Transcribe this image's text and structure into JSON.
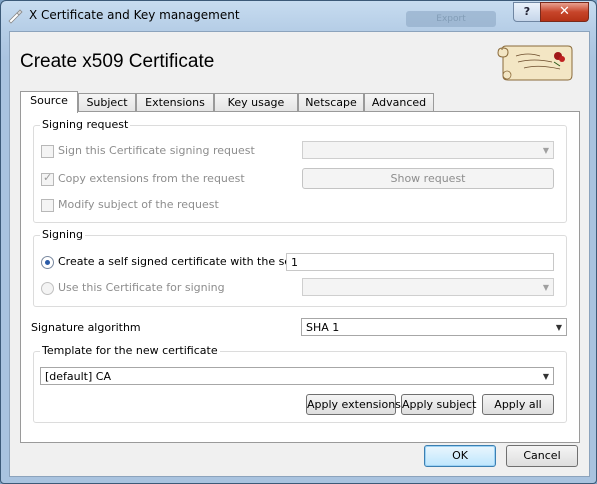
{
  "window": {
    "title": "X Certificate and Key management",
    "background_tab": "Export",
    "help_label": "?",
    "close_label": "✕"
  },
  "heading": "Create x509 Certificate",
  "tabs": [
    "Source",
    "Subject",
    "Extensions",
    "Key usage",
    "Netscape",
    "Advanced"
  ],
  "active_tab": "Source",
  "signing_request": {
    "legend": "Signing request",
    "sign_csr_label": "Sign this Certificate signing request",
    "sign_csr_checked": false,
    "copy_ext_label": "Copy extensions from the request",
    "copy_ext_checked": true,
    "modify_subject_label": "Modify subject of the request",
    "modify_subject_checked": false,
    "request_combo_value": "",
    "show_request_label": "Show request"
  },
  "signing": {
    "legend": "Signing",
    "self_signed_label": "Create a self signed certificate with the serial",
    "self_signed_selected": true,
    "serial_value": "1",
    "use_cert_label": "Use this Certificate for signing",
    "use_cert_selected": false,
    "cert_combo_value": ""
  },
  "signature_algorithm": {
    "label": "Signature algorithm",
    "value": "SHA 1"
  },
  "template": {
    "legend": "Template for the new certificate",
    "value": "[default] CA",
    "apply_extensions_label": "Apply extensions",
    "apply_subject_label": "Apply subject",
    "apply_all_label": "Apply all"
  },
  "buttons": {
    "ok": "OK",
    "cancel": "Cancel"
  },
  "colors": {
    "title_bar": "#b5cde6",
    "close_button": "#c7452a",
    "radio_dot": "#2a5ba8"
  }
}
